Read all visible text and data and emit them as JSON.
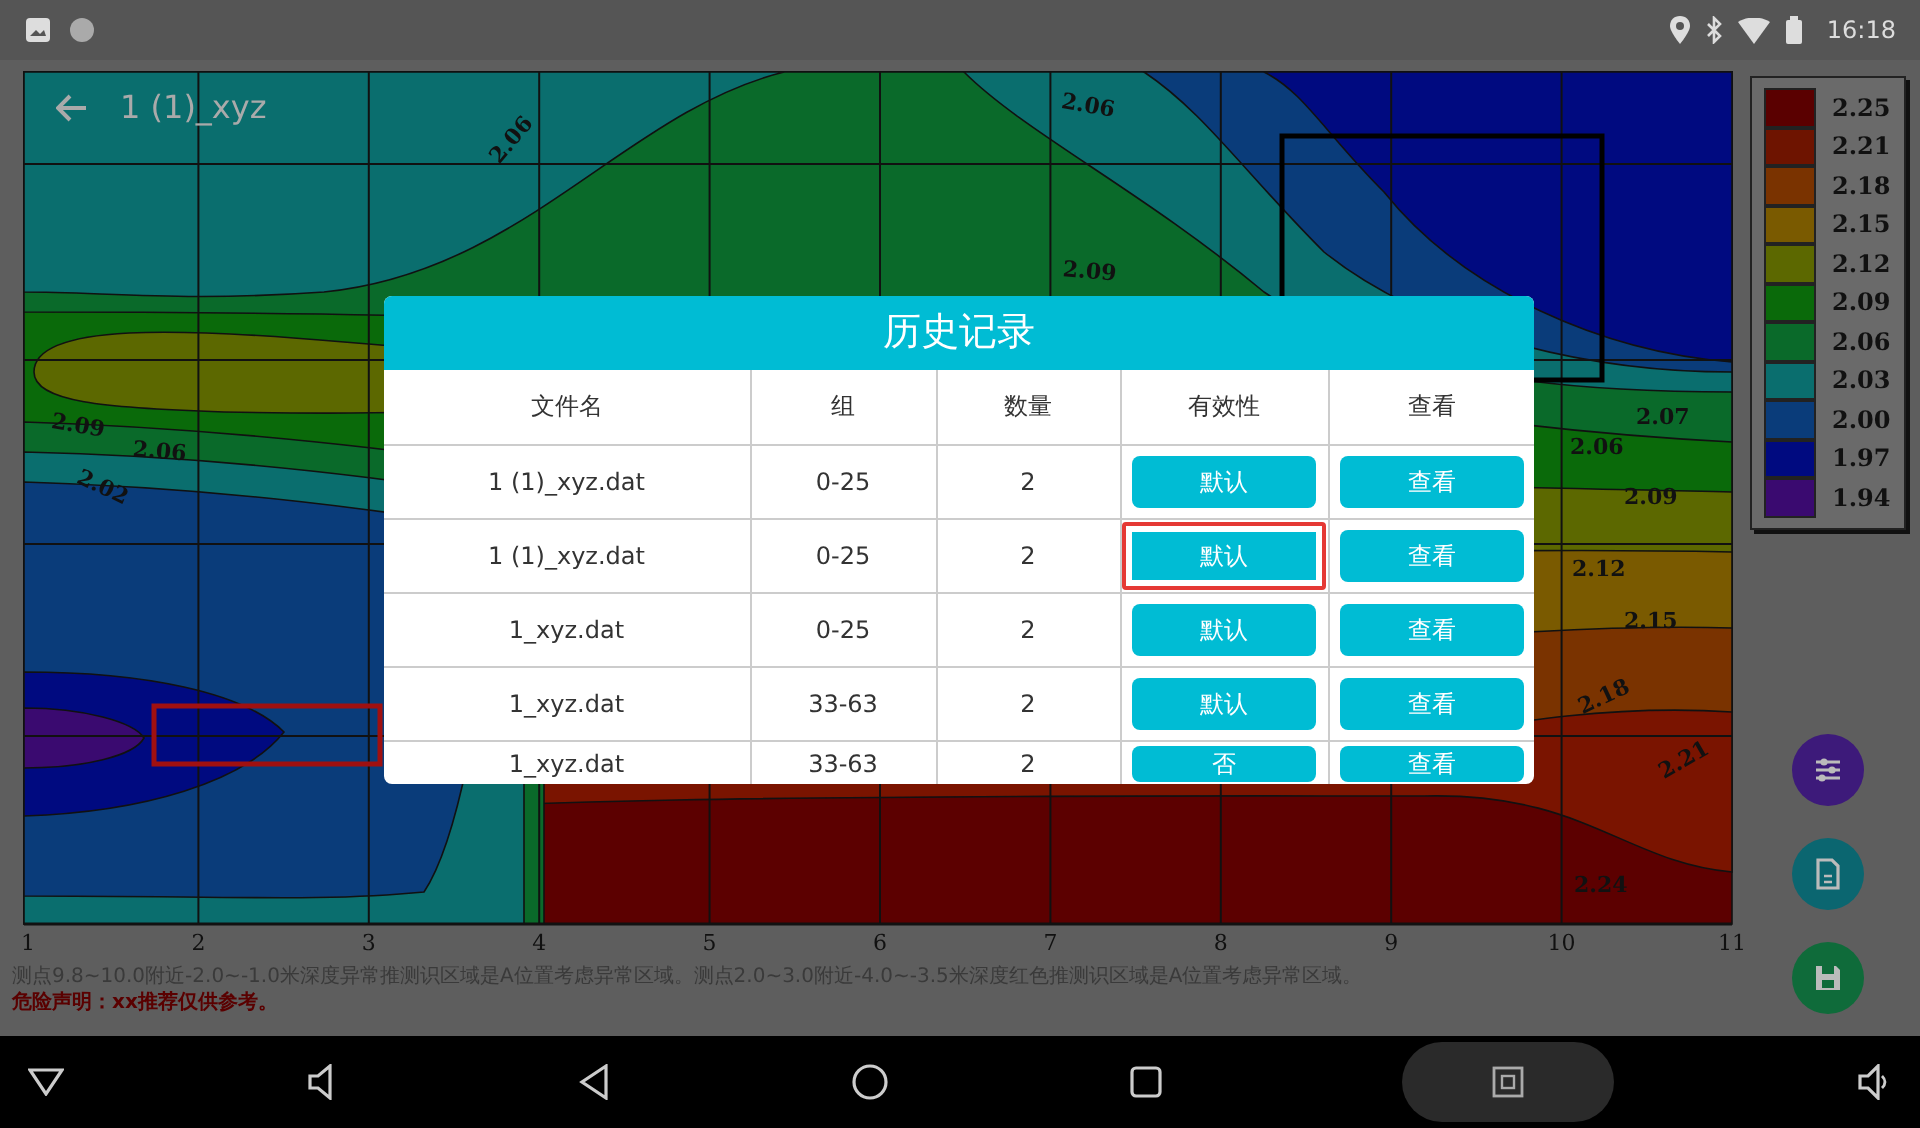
{
  "status_bar": {
    "time": "16:18"
  },
  "app_bar": {
    "title": "1 (1)_xyz"
  },
  "contour_map": {
    "contour_labels": [
      "2.06",
      "2.06",
      "2.09",
      "2.09",
      "2.06",
      "2.02",
      "2.07",
      "2.06",
      "2.09",
      "2.12",
      "2.15",
      "2.18",
      "2.21",
      "2.24"
    ],
    "x_axis_ticks": [
      "1",
      "2",
      "3",
      "4",
      "5",
      "6",
      "7",
      "8",
      "9",
      "10",
      "11"
    ]
  },
  "legend": [
    {
      "label": "2.25",
      "color": "#5a0000"
    },
    {
      "label": "2.21",
      "color": "#6e1400"
    },
    {
      "label": "2.18",
      "color": "#7a3300"
    },
    {
      "label": "2.15",
      "color": "#7a5a00"
    },
    {
      "label": "2.12",
      "color": "#5c6800"
    },
    {
      "label": "2.09",
      "color": "#0a6a0a"
    },
    {
      "label": "2.06",
      "color": "#0a6a2a"
    },
    {
      "label": "2.03",
      "color": "#0a6e6e"
    },
    {
      "label": "2.00",
      "color": "#0a3c7a"
    },
    {
      "label": "1.97",
      "color": "#000a80"
    },
    {
      "label": "1.94",
      "color": "#3a0a70"
    }
  ],
  "notes": [
    {
      "kind": "remark",
      "text": "测点9.8~10.0附近-2.0~-1.0米深度异常推测识区域是A位置考虑异常区域。测点2.0~3.0附近-4.0~-3.5米深度红色推测识区域是A位置考虑异常区域。"
    },
    {
      "kind": "warning",
      "text": "危险声明：xx推荐仅供参考。"
    }
  ],
  "fab_buttons": [
    {
      "kind": "adjust",
      "color": "#3d1a7a"
    },
    {
      "kind": "file",
      "color": "#0b6670"
    },
    {
      "kind": "save",
      "color": "#0f6b3a"
    }
  ],
  "dialog": {
    "title": "历史记录",
    "columns": [
      "文件名",
      "组",
      "数量",
      "有效性",
      "查看"
    ],
    "rows": [
      {
        "file": "1 (1)_xyz.dat",
        "group": "0-25",
        "count": "2",
        "validity": "默认",
        "view": "查看",
        "focused": false
      },
      {
        "file": "1 (1)_xyz.dat",
        "group": "0-25",
        "count": "2",
        "validity": "默认",
        "view": "查看",
        "focused": true
      },
      {
        "file": "1_xyz.dat",
        "group": "0-25",
        "count": "2",
        "validity": "默认",
        "view": "查看",
        "focused": false
      },
      {
        "file": "1_xyz.dat",
        "group": "33-63",
        "count": "2",
        "validity": "默认",
        "view": "查看",
        "focused": false
      },
      {
        "file": "1_xyz.dat",
        "group": "33-63",
        "count": "2",
        "validity": "否",
        "view": "查看",
        "focused": false
      }
    ]
  }
}
